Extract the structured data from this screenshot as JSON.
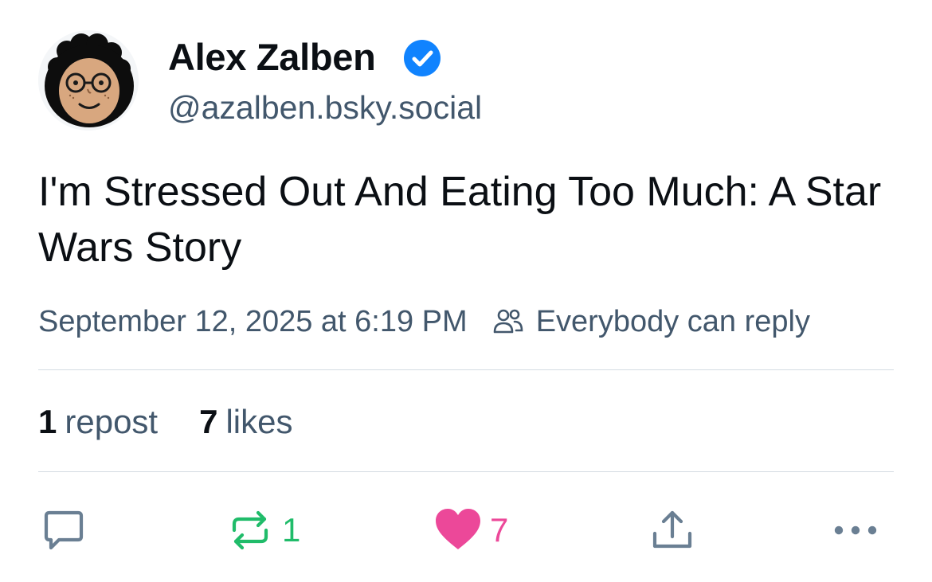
{
  "author": {
    "display_name": "Alex Zalben",
    "handle": "@azalben.bsky.social",
    "verified": true
  },
  "post": {
    "text": "I'm Stressed Out And Eating Too Much: A Star Wars Story",
    "timestamp": "September 12, 2025 at 6:19 PM",
    "reply_setting": "Everybody can reply"
  },
  "stats": {
    "reposts_count": "1",
    "reposts_label": "repost",
    "likes_count": "7",
    "likes_label": "likes"
  },
  "actions": {
    "repost_count": "1",
    "like_count": "7"
  },
  "icons": {
    "verified": "verified-check-icon",
    "reply_setting": "people-icon",
    "reply": "speech-bubble-icon",
    "repost": "repost-arrows-icon",
    "like": "heart-icon",
    "share": "share-upload-icon",
    "more": "ellipsis-icon"
  },
  "colors": {
    "verified_blue": "#1083fe",
    "repost_green": "#20bc6a",
    "like_pink": "#ec4899",
    "muted_text": "#42576c",
    "divider": "#d4dbe2"
  }
}
